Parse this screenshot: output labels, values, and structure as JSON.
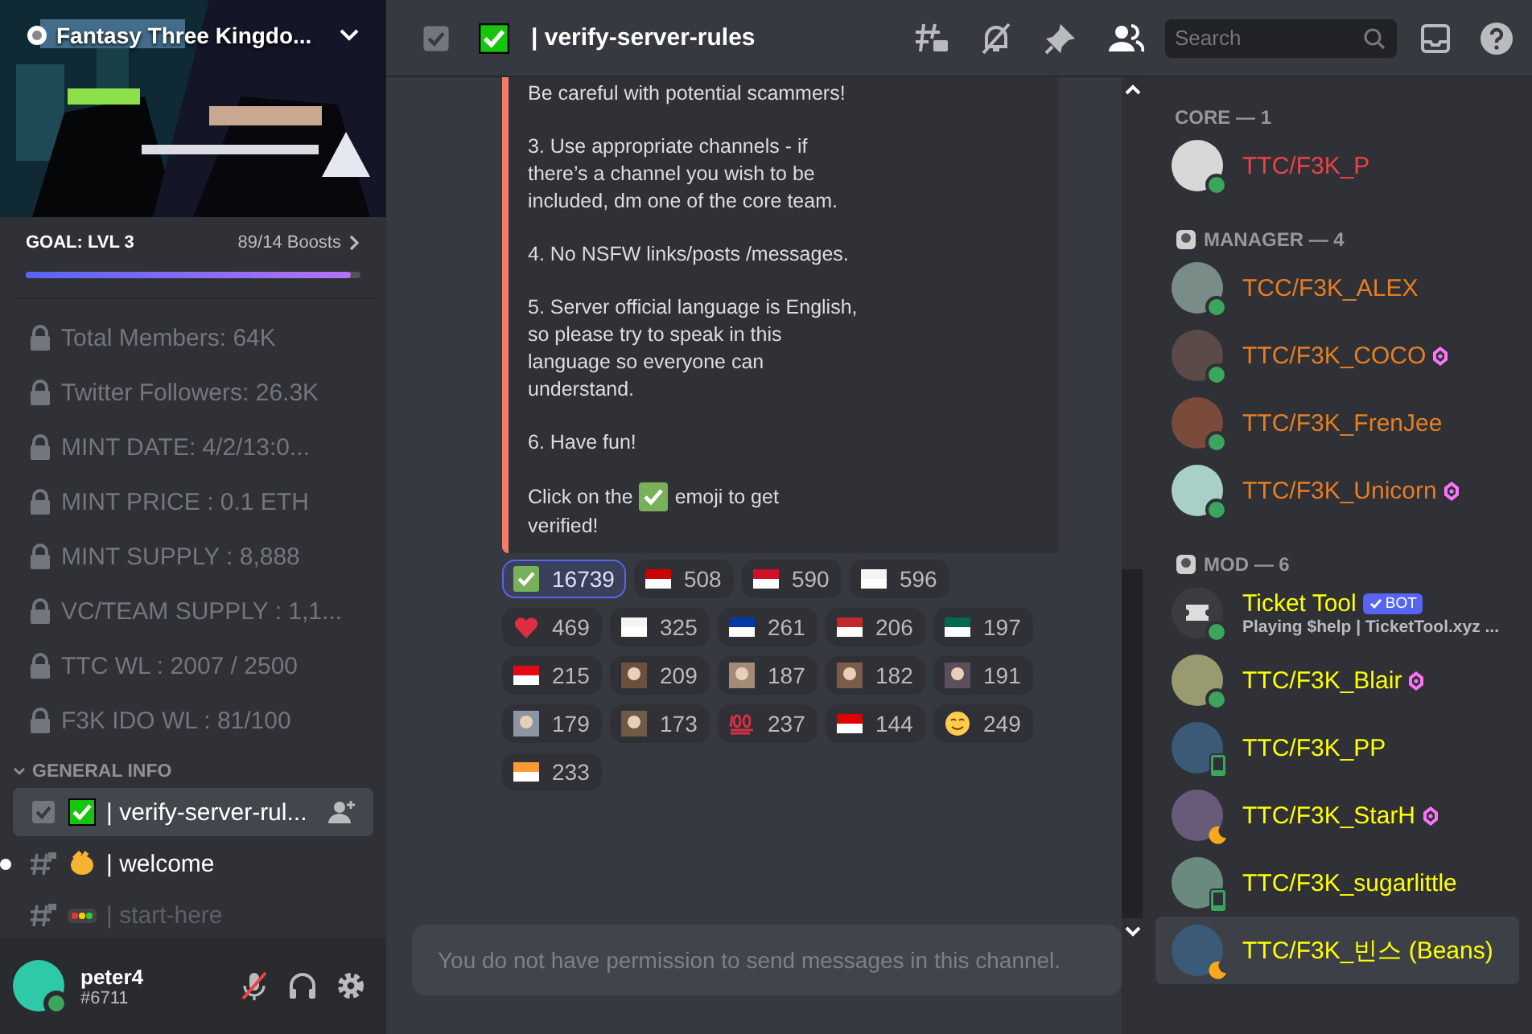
{
  "server": {
    "name": "Fantasy Three Kingdo...",
    "boost_goal": "GOAL: LVL 3",
    "boost_count": "89/14 Boosts",
    "level": 0.97
  },
  "info_channels": [
    {
      "name": "Total Members: 64K"
    },
    {
      "name": "Twitter Followers: 26.3K"
    },
    {
      "name": "MINT DATE: 4/2/13:0..."
    },
    {
      "name": "MINT PRICE : 0.1 ETH"
    },
    {
      "name": "MINT SUPPLY : 8,888"
    },
    {
      "name": "VC/TEAM SUPPLY : 1,1..."
    },
    {
      "name": "TTC WL : 2007 / 2500"
    },
    {
      "name": "F3K IDO WL :  81/100"
    }
  ],
  "category": {
    "name": "GENERAL INFO",
    "expanded": true,
    "channels": [
      {
        "kind": "rules",
        "name": "| verify-server-rul...",
        "selected": true,
        "unread": false,
        "muted": false
      },
      {
        "kind": "hash",
        "name": "| welcome",
        "selected": false,
        "unread": true,
        "muted": false
      },
      {
        "kind": "hash",
        "name": "| start-here",
        "selected": false,
        "unread": false,
        "muted": true
      }
    ]
  },
  "user": {
    "name": "peter4",
    "tag": "#6711",
    "mic_muted": true
  },
  "header": {
    "channel": "| verify-server-rules",
    "search": {
      "placeholder": "Search"
    }
  },
  "message": {
    "paragraphs": [
      "Be careful with potential scammers!",
      "3. Use appropriate channels - if there’s a channel you wish to be included, dm one of the core team.",
      "4. No NSFW links/posts /messages.",
      "5. Server official language is English, so please try to speak in this language so everyone can understand.",
      "6. Have fun!"
    ],
    "closing_before": "Click on the",
    "closing_after": "emoji to get",
    "closing_end": "verified!"
  },
  "reactions": [
    {
      "kind": "check",
      "count": "16739",
      "selected": true
    },
    {
      "kind": "flag",
      "color": "#cc0001",
      "count": "508",
      "selected": false
    },
    {
      "kind": "flag",
      "color": "#ce1126",
      "count": "590",
      "selected": false
    },
    {
      "kind": "flag",
      "color": "#f4f4f4",
      "count": "596",
      "selected": false
    },
    {
      "kind": "heart",
      "count": "469",
      "selected": false
    },
    {
      "kind": "flag",
      "color": "#f5f5f5",
      "count": "325",
      "selected": false
    },
    {
      "kind": "flag",
      "color": "#0038a8",
      "count": "261",
      "selected": false
    },
    {
      "kind": "flag",
      "color": "#c1272d",
      "count": "206",
      "selected": false
    },
    {
      "kind": "flag",
      "color": "#006a4e",
      "count": "197",
      "selected": false
    },
    {
      "kind": "flag",
      "color": "#e30a17",
      "count": "215",
      "selected": false
    },
    {
      "kind": "custom",
      "color": "#6b5040",
      "count": "209",
      "selected": false
    },
    {
      "kind": "custom",
      "color": "#a08c78",
      "count": "187",
      "selected": false
    },
    {
      "kind": "custom",
      "color": "#7a5c4c",
      "count": "182",
      "selected": false
    },
    {
      "kind": "custom",
      "color": "#5c4e5a",
      "count": "191",
      "selected": false
    },
    {
      "kind": "custom",
      "color": "#8c96a0",
      "count": "179",
      "selected": false
    },
    {
      "kind": "custom",
      "color": "#6e5a46",
      "count": "173",
      "selected": false
    },
    {
      "kind": "hundred",
      "count": "237",
      "selected": false
    },
    {
      "kind": "flag",
      "color": "#dd0000",
      "count": "144",
      "selected": false
    },
    {
      "kind": "smile",
      "count": "249",
      "selected": false
    },
    {
      "kind": "flag",
      "color": "#ff9933",
      "count": "233",
      "selected": false
    }
  ],
  "composer": {
    "placeholder": "You do not have permission to send messages in this channel."
  },
  "member_groups": [
    {
      "title": "CORE — 1",
      "kind": "plain",
      "members": [
        {
          "name": "TTC/F3K_P",
          "color": "#ed4245",
          "kind": "online",
          "booster": false,
          "hovered": false
        }
      ]
    },
    {
      "title": "MANAGER — 4",
      "kind": "role",
      "members": [
        {
          "name": "TCC/F3K_ALEX",
          "color": "#e67e22",
          "kind": "online",
          "booster": false,
          "hovered": false
        },
        {
          "name": "TTC/F3K_COCO",
          "color": "#e67e22",
          "kind": "online",
          "booster": true,
          "hovered": false
        },
        {
          "name": "TTC/F3K_FrenJee",
          "color": "#e67e22",
          "kind": "online",
          "booster": false,
          "hovered": false
        },
        {
          "name": "TTC/F3K_Unicorn",
          "color": "#e67e22",
          "kind": "online",
          "booster": true,
          "hovered": false
        }
      ]
    },
    {
      "title": "MOD — 6",
      "kind": "role",
      "members": [
        {
          "name": "Ticket Tool",
          "color": "#ffff00",
          "kind": "online",
          "booster": false,
          "hovered": false,
          "bot": "BOT",
          "activity": "Playing $help | TicketTool.xyz ..."
        },
        {
          "name": "TTC/F3K_Blair",
          "color": "#ffff00",
          "kind": "online",
          "booster": true,
          "hovered": false
        },
        {
          "name": "TTC/F3K_PP",
          "color": "#ffff00",
          "kind": "mobile",
          "booster": false,
          "hovered": false
        },
        {
          "name": "TTC/F3K_StarH",
          "color": "#ffff00",
          "kind": "idle",
          "booster": true,
          "hovered": false
        },
        {
          "name": "TTC/F3K_sugarlittle",
          "color": "#ffff00",
          "kind": "mobile",
          "booster": false,
          "hovered": false
        },
        {
          "name": "TTC/F3K_빈스 (Beans)",
          "color": "#ffff00",
          "kind": "idle",
          "booster": false,
          "hovered": true
        }
      ]
    }
  ]
}
